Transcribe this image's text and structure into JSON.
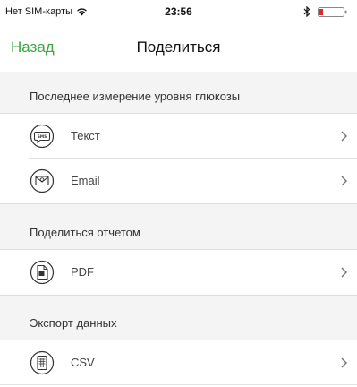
{
  "status": {
    "carrier": "Нет SIM-карты",
    "time": "23:56"
  },
  "nav": {
    "back_label": "Назад",
    "title": "Поделиться"
  },
  "sections": [
    {
      "header": "Последнее измерение уровня глюкозы",
      "items": [
        {
          "label": "Текст",
          "icon": "sms-icon"
        },
        {
          "label": "Email",
          "icon": "email-icon"
        }
      ]
    },
    {
      "header": "Поделиться отчетом",
      "items": [
        {
          "label": "PDF",
          "icon": "pdf-icon"
        }
      ]
    },
    {
      "header": "Экспорт данных",
      "items": [
        {
          "label": "CSV",
          "icon": "csv-icon"
        }
      ]
    }
  ],
  "colors": {
    "accent": "#3aa741",
    "section_bg": "#f4f4f4",
    "battery_low": "#e0262b"
  }
}
